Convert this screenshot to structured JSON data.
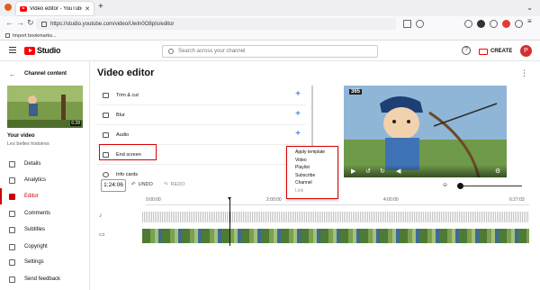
{
  "browser": {
    "tab_title": "Video editor - YouTube Studio",
    "tab_close": "✕",
    "new_tab": "+",
    "url": "https://studio.youtube.com/video/UwIn0O8pIs/editor",
    "bookmarks_label": "Import bookmarks..."
  },
  "header": {
    "logo_text": "Studio",
    "search_placeholder": "Search across your channel",
    "help_label": "?",
    "create_label": "CREATE",
    "avatar_initial": "P"
  },
  "sidebar": {
    "title": "Channel content",
    "your_video_label": "Your video",
    "video_name": "Les belles histoires",
    "thumb_duration": "6:28",
    "items": [
      {
        "label": "Details"
      },
      {
        "label": "Analytics"
      },
      {
        "label": "Editor"
      },
      {
        "label": "Comments"
      },
      {
        "label": "Subtitles"
      },
      {
        "label": "Copyright"
      },
      {
        "label": "Settings"
      },
      {
        "label": "Send feedback"
      }
    ]
  },
  "main": {
    "title": "Video editor",
    "tools": [
      {
        "label": "Trim & cut"
      },
      {
        "label": "Blur"
      },
      {
        "label": "Audio"
      },
      {
        "label": "End screen"
      },
      {
        "label": "Info cards"
      }
    ],
    "preview_badge": "365"
  },
  "menu": {
    "items": [
      {
        "label": "Apply template",
        "disabled": false
      },
      {
        "label": "Video",
        "disabled": false
      },
      {
        "label": "Playlist",
        "disabled": false
      },
      {
        "label": "Subscribe",
        "disabled": false
      },
      {
        "label": "Channel",
        "disabled": false
      },
      {
        "label": "Link",
        "disabled": true
      }
    ]
  },
  "timeline": {
    "current_time": "1:24:06",
    "undo_label": "UNDO",
    "redo_label": "REDO",
    "ruler": [
      "0:00:00",
      "2:00:00",
      "4:00:00",
      "6:27:03"
    ]
  }
}
